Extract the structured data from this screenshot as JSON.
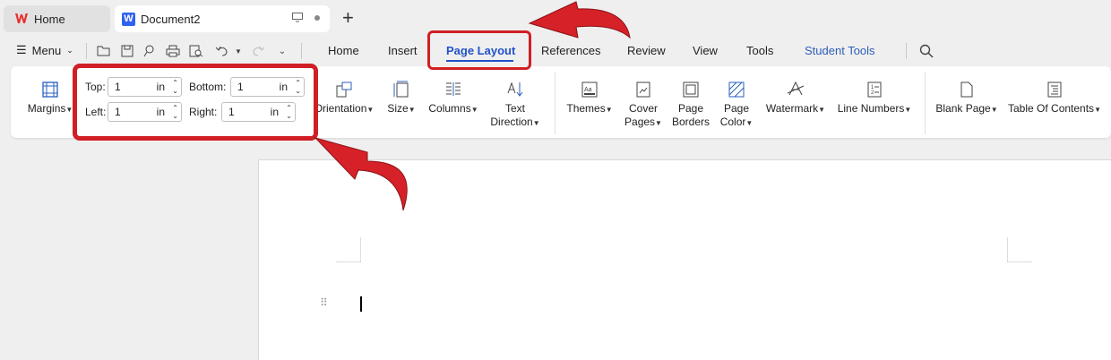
{
  "tabs": {
    "home_label": "Home",
    "doc_label": "Document2",
    "doc_logo_letter": "W"
  },
  "menu": {
    "label": "Menu"
  },
  "ribbon_tabs": [
    "Home",
    "Insert",
    "Page Layout",
    "References",
    "Review",
    "View",
    "Tools",
    "Student Tools"
  ],
  "ribbon": {
    "margins": "Margins",
    "top_label": "Top:",
    "bottom_label": "Bottom:",
    "left_label": "Left:",
    "right_label": "Right:",
    "top_value": "1",
    "bottom_value": "1",
    "left_value": "1",
    "right_value": "1",
    "unit": "in",
    "orientation": "Orientation",
    "size": "Size",
    "columns": "Columns",
    "text_direction_1": "Text",
    "text_direction_2": "Direction",
    "themes": "Themes",
    "cover_pages_1": "Cover",
    "cover_pages_2": "Pages",
    "page_borders_1": "Page",
    "page_borders_2": "Borders",
    "page_color_1": "Page",
    "page_color_2": "Color",
    "watermark": "Watermark",
    "line_numbers": "Line Numbers",
    "blank_page": "Blank Page",
    "table_of_contents": "Table Of Contents"
  },
  "colors": {
    "accent": "#2052c9",
    "highlight": "#d01f25",
    "wps_red": "#e8302b"
  }
}
